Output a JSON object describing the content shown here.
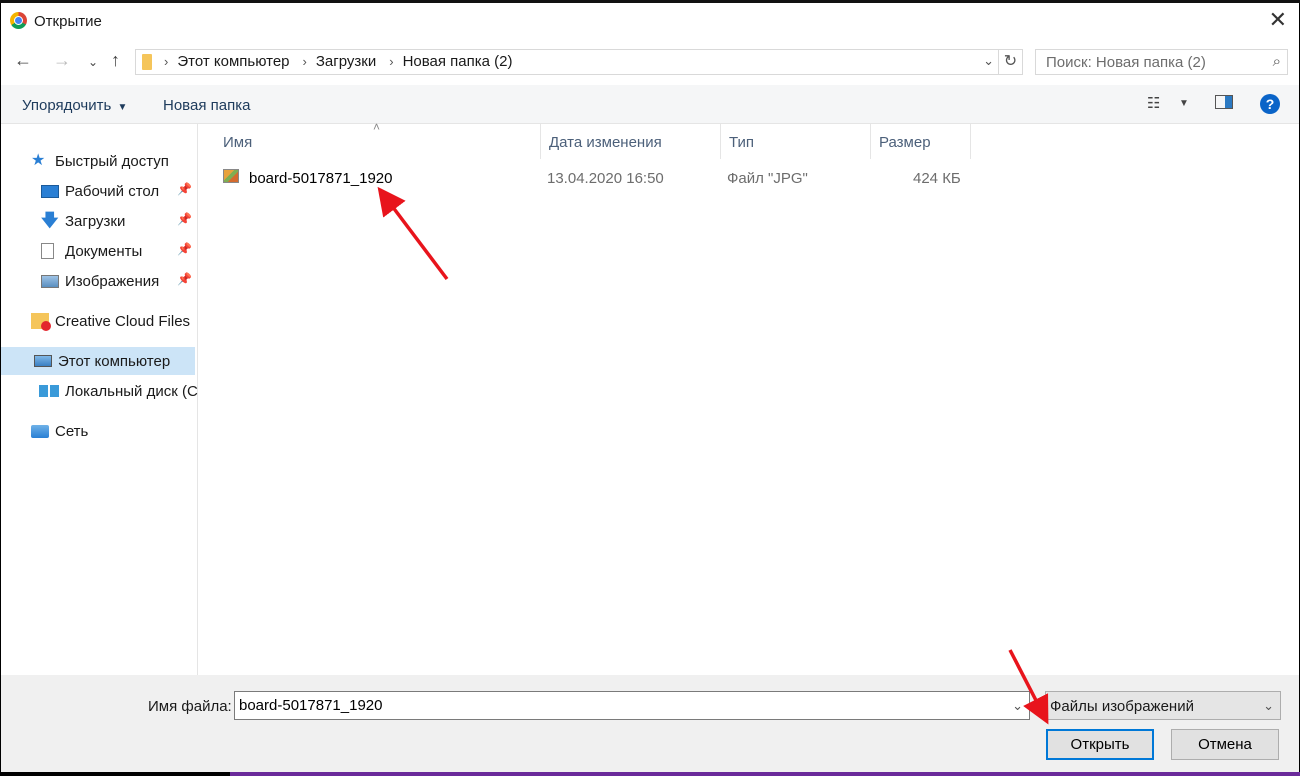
{
  "window": {
    "title": "Открытие"
  },
  "navbar": {
    "breadcrumbs": [
      "Этот компьютер",
      "Загрузки",
      "Новая папка (2)"
    ],
    "search_placeholder": "Поиск: Новая папка (2)"
  },
  "toolbar": {
    "organize_label": "Упорядочить",
    "new_folder_label": "Новая папка"
  },
  "sidebar": {
    "items": [
      {
        "label": "Быстрый доступ",
        "icon": "star-icon"
      },
      {
        "label": "Рабочий стол",
        "icon": "desktop-icon",
        "pinned": true
      },
      {
        "label": "Загрузки",
        "icon": "download-icon",
        "pinned": true
      },
      {
        "label": "Документы",
        "icon": "documents-icon",
        "pinned": true
      },
      {
        "label": "Изображения",
        "icon": "pictures-icon",
        "pinned": true
      },
      {
        "label": "Creative Cloud Files",
        "icon": "creative-cloud-icon"
      },
      {
        "label": "Этот компьютер",
        "icon": "computer-icon",
        "selected": true
      },
      {
        "label": "Локальный диск (C",
        "icon": "drive-icon"
      },
      {
        "label": "Сеть",
        "icon": "network-icon"
      }
    ]
  },
  "columns": {
    "name": "Имя",
    "date": "Дата изменения",
    "type": "Тип",
    "size": "Размер"
  },
  "files": [
    {
      "name": "board-5017871_1920",
      "date": "13.04.2020 16:50",
      "type": "Файл \"JPG\"",
      "size": "424 КБ"
    }
  ],
  "footer": {
    "filename_label": "Имя файла:",
    "filename_value": "board-5017871_1920",
    "filetype_value": "Файлы изображений",
    "open_label": "Открыть",
    "cancel_label": "Отмена"
  },
  "colors": {
    "selection": "#cce4f7",
    "accent": "#0078d7",
    "annotation_arrow": "#e8141c"
  }
}
